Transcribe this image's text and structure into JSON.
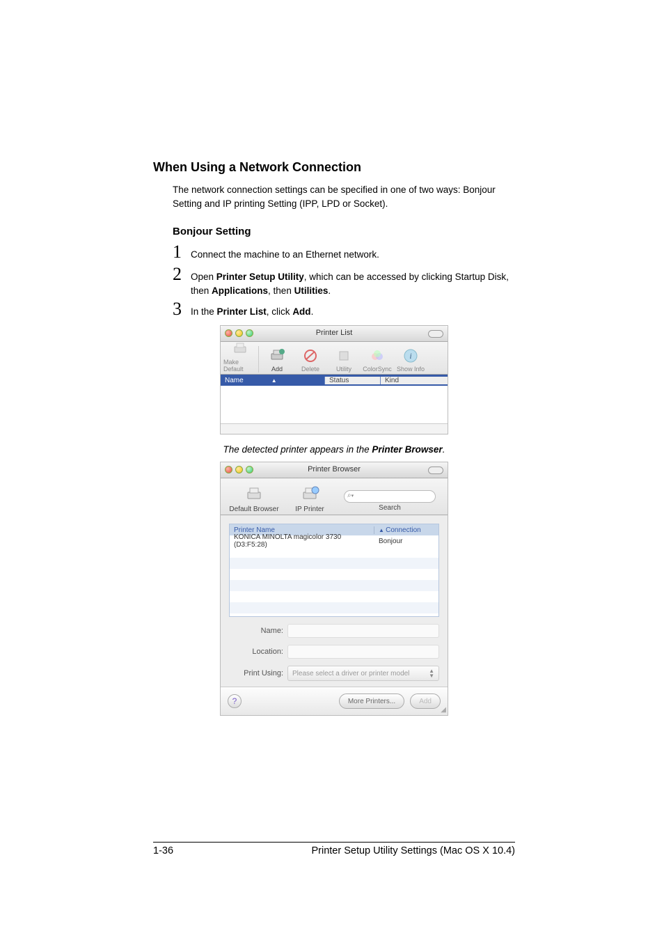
{
  "heading": "When Using a Network Connection",
  "intro": "The network connection settings can be specified in one of two ways: Bonjour Setting and IP printing Setting (IPP, LPD or Socket).",
  "subheading": "Bonjour Setting",
  "steps": [
    {
      "num": "1",
      "text": "Connect the machine to an Ethernet network."
    },
    {
      "num": "2",
      "pre": "Open ",
      "b1": "Printer Setup Utility",
      "mid1": ", which can be accessed by clicking Startup Disk, then ",
      "b2": "Applications",
      "mid2": ", then ",
      "b3": "Utilities",
      "end": "."
    },
    {
      "num": "3",
      "pre": "In the ",
      "b1": "Printer List",
      "mid1": ", click ",
      "b2": "Add",
      "end": "."
    }
  ],
  "caption_pre": "The detected printer appears in the ",
  "caption_bold": "Printer Browser",
  "caption_end": ".",
  "fig1": {
    "title": "Printer List",
    "toolbar": {
      "make_default": "Make Default",
      "add": "Add",
      "delete": "Delete",
      "utility": "Utility",
      "colorsync": "ColorSync",
      "show_info": "Show Info"
    },
    "cols": {
      "name": "Name",
      "status": "Status",
      "kind": "Kind"
    }
  },
  "fig2": {
    "title": "Printer Browser",
    "tabs": {
      "default": "Default Browser",
      "ip": "IP Printer",
      "search": "Search"
    },
    "list": {
      "col_name": "Printer Name",
      "col_conn": "Connection",
      "row_name": "KONICA MINOLTA magicolor 3730 (D3:F5:28)",
      "row_conn": "Bonjour"
    },
    "form": {
      "name": "Name:",
      "location": "Location:",
      "print_using": "Print Using:",
      "pu_value": "Please select a driver or printer model"
    },
    "footer": {
      "more": "More Printers...",
      "add": "Add"
    },
    "search_placeholder": "Q"
  },
  "page_footer": {
    "left": "1-36",
    "right": "Printer Setup Utility Settings (Mac OS X 10.4)"
  }
}
